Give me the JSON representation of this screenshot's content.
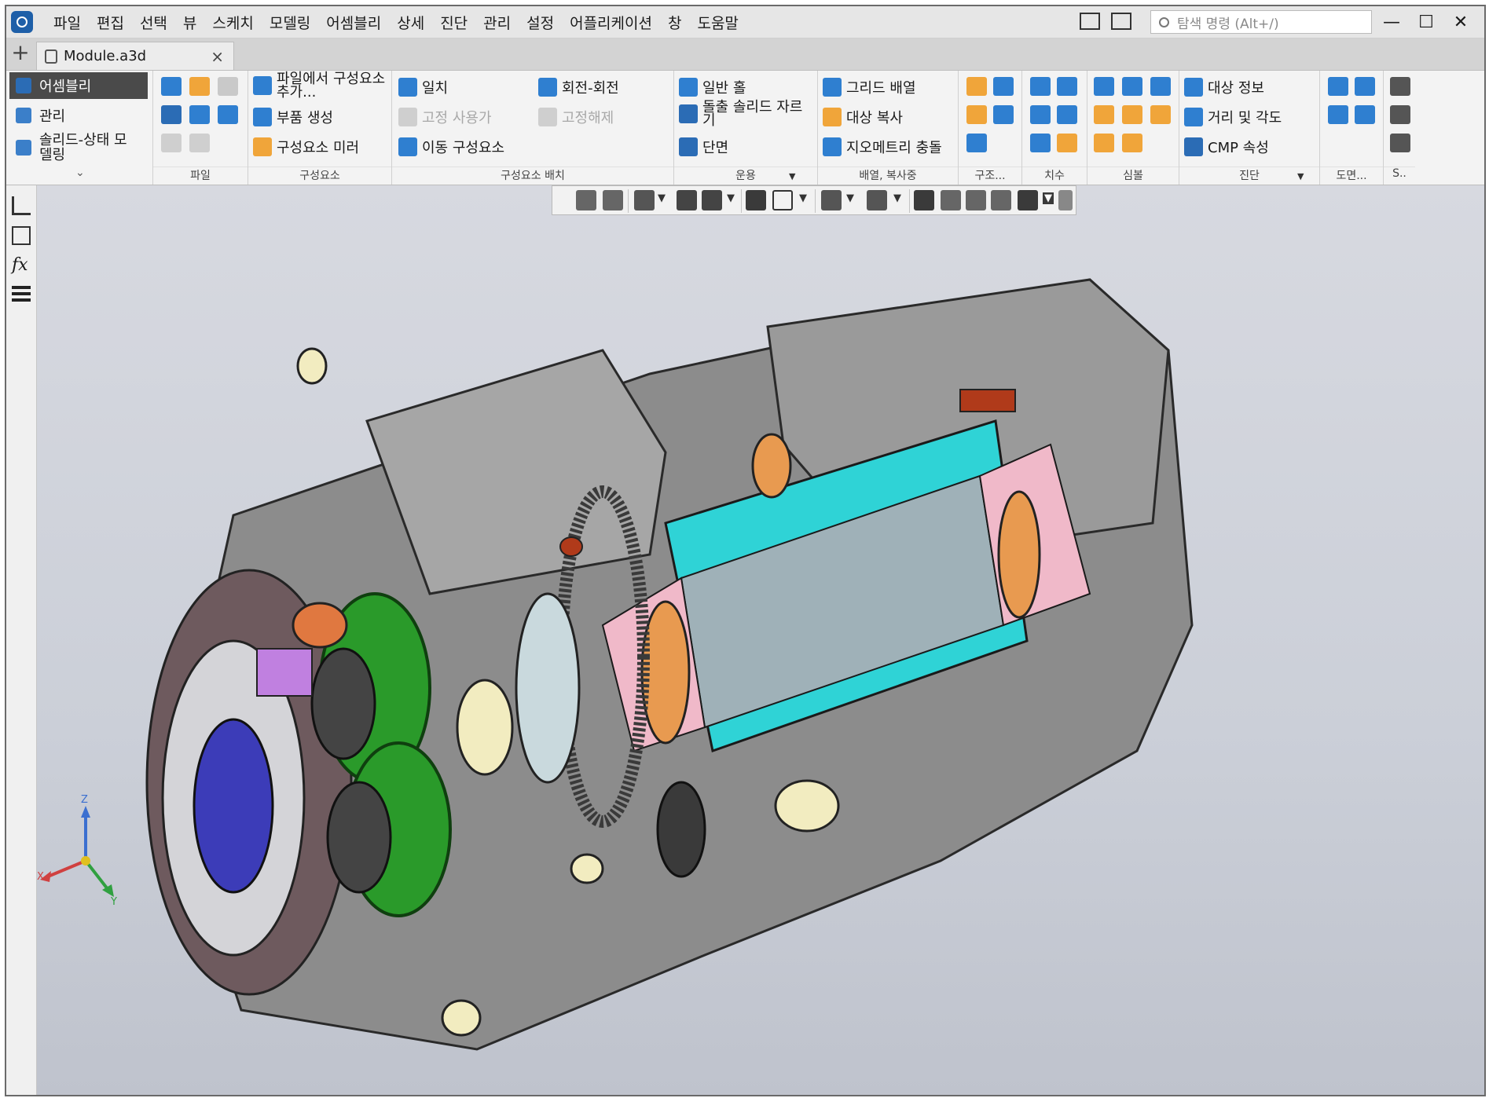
{
  "menu": [
    "파일",
    "편집",
    "선택",
    "뷰",
    "스케치",
    "모델링",
    "어셈블리",
    "상세",
    "진단",
    "관리",
    "설정",
    "어플리케이션",
    "창",
    "도움말"
  ],
  "search": {
    "placeholder": "탐색 명령 (Alt+/)"
  },
  "window_controls": {
    "minimize": "—",
    "maximize": "☐",
    "close": "✕"
  },
  "document_tab": {
    "name": "Module.a3d",
    "close": "×"
  },
  "new_tab": "+",
  "modes": [
    {
      "label": "어셈블리",
      "active": true
    },
    {
      "label": "관리",
      "active": false
    },
    {
      "label": "솔리드-상태 모델링",
      "active": false
    }
  ],
  "ribbon": {
    "groups": [
      "파일",
      "구성요소",
      "구성요소 배치",
      "운용",
      "배열, 복사중",
      "구조...",
      "치수",
      "심볼",
      "진단",
      "도면...",
      "S.."
    ],
    "component": {
      "from_file": "파일에서 구성요소 추가...",
      "create_part": "부품 생성",
      "mirror": "구성요소 미러"
    },
    "placement": {
      "coincide": "일치",
      "rotate": "회전-회전",
      "fix_use": "고정 사용가",
      "unfix": "고정해제",
      "move": "이동 구성요소"
    },
    "operation": {
      "hole": "일반 홀",
      "cut": "돌출 솔리드 자르기",
      "section": "단면"
    },
    "array": {
      "grid": "그리드 배열",
      "copy": "대상 복사",
      "collision": "지오메트리 충돌"
    },
    "diagnostics": {
      "info": "대상 정보",
      "distance": "거리 및 각도",
      "cmp": "CMP 속성"
    }
  },
  "axes": {
    "x": "X",
    "y": "Y",
    "z": "Z"
  },
  "colors": {
    "teal": "#2fd3d6",
    "pink": "#f0b9c9",
    "gear_green": "#2a9a2a",
    "orange": "#e07840",
    "housing": "#8a8a8a",
    "accent_blue": "#1e5fa8"
  }
}
